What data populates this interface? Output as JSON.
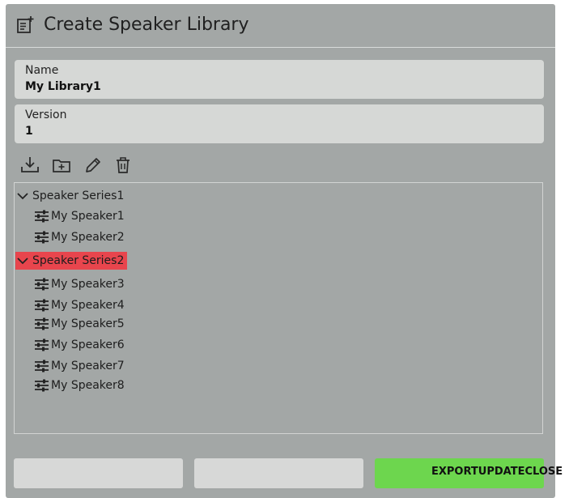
{
  "dialog": {
    "title": "Create Speaker Library",
    "header_icon": "add-document-icon"
  },
  "fields": {
    "name": {
      "label": "Name",
      "value": "My Library1"
    },
    "version": {
      "label": "Version",
      "value": "1"
    }
  },
  "toolbar": {
    "icons": [
      "download-icon",
      "add-folder-icon",
      "pencil-icon",
      "trash-icon"
    ]
  },
  "tree": {
    "series": [
      {
        "label": "Speaker Series1",
        "expanded": true,
        "selected": false,
        "items": [
          "My Speaker1",
          "My Speaker2"
        ]
      },
      {
        "label": "Speaker Series2",
        "expanded": true,
        "selected": true,
        "items": [
          "My Speaker3",
          "My Speaker4",
          "My Speaker5",
          "My Speaker6",
          "My Speaker7",
          "My Speaker8"
        ]
      }
    ],
    "item_icon": "sliders-icon",
    "selected_color": "#e8454d"
  },
  "footer": {
    "export_label": "EXPORT",
    "update_label": "UPDATE",
    "close_label": "CLOSE",
    "primary_color": "#6dd64e"
  }
}
